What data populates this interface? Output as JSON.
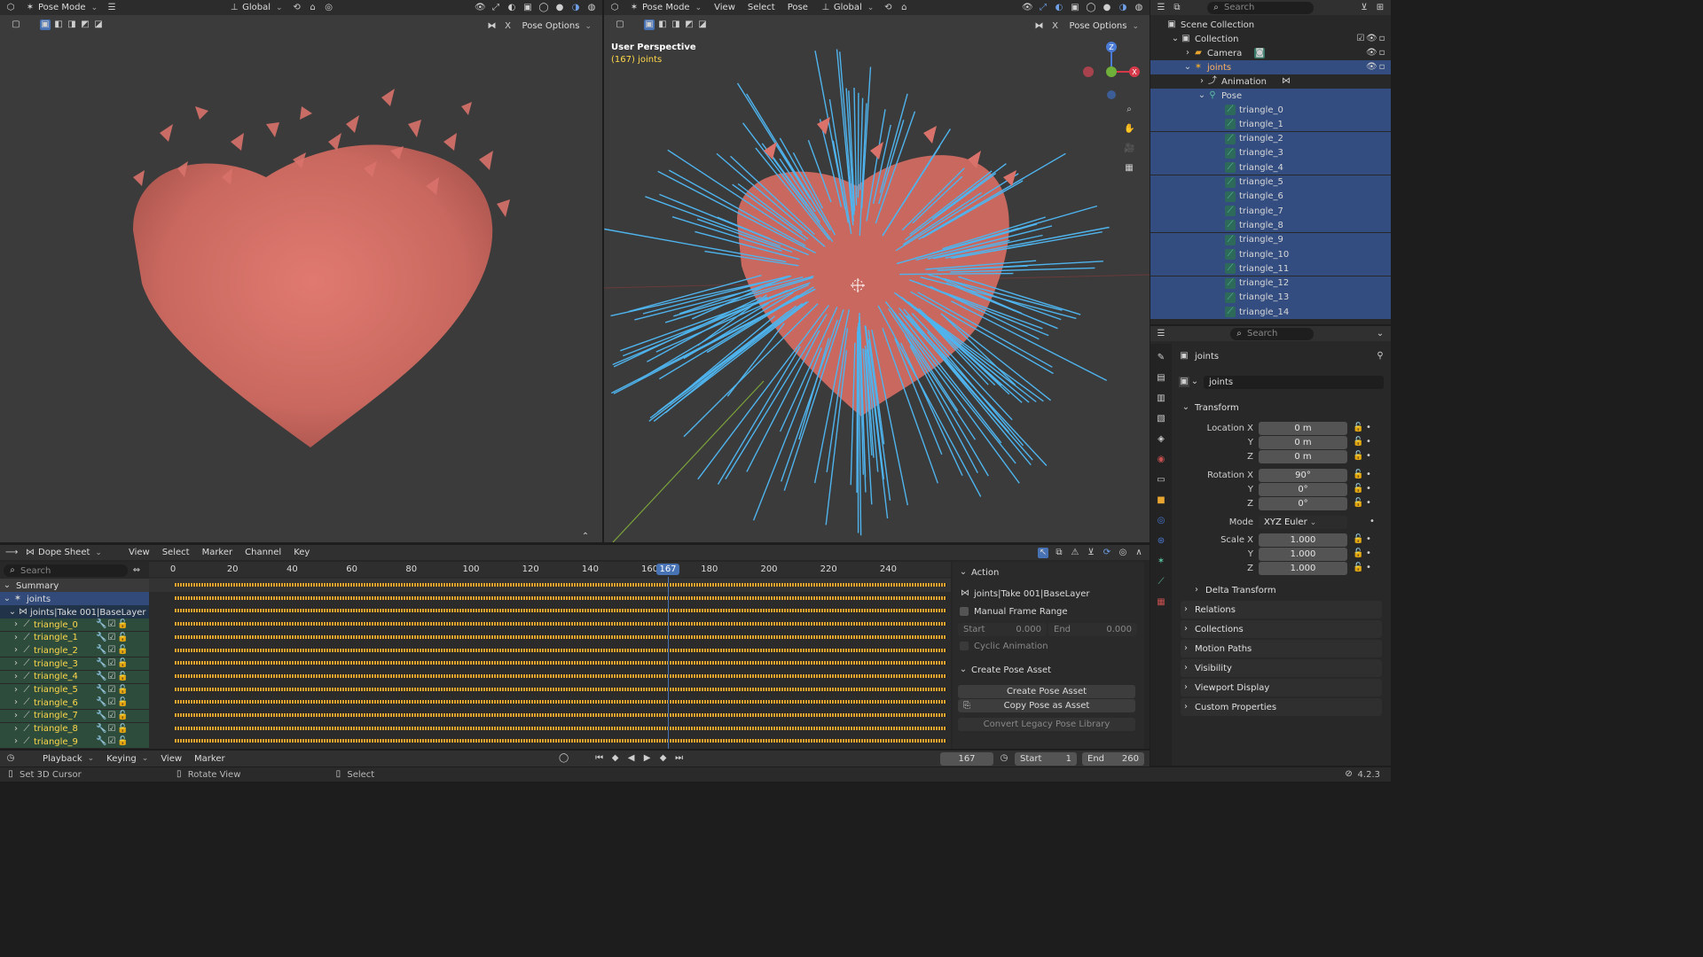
{
  "vp_left_header": {
    "mode": "Pose Mode",
    "transform": "Global",
    "pose_options": "Pose Options"
  },
  "vp_right_header": {
    "mode": "Pose Mode",
    "menus": [
      "View",
      "Select",
      "Pose"
    ],
    "transform": "Global",
    "pose_options": "Pose Options",
    "overlay_title": "User Perspective",
    "overlay_sub": "(167) joints"
  },
  "outliner": {
    "search_placeholder": "Search",
    "scene_collection": "Scene Collection",
    "collection": "Collection",
    "camera": "Camera",
    "joints": "joints",
    "animation": "Animation",
    "pose": "Pose",
    "bones": [
      "triangle_0",
      "triangle_1",
      "triangle_2",
      "triangle_3",
      "triangle_4",
      "triangle_5",
      "triangle_6",
      "triangle_7",
      "triangle_8",
      "triangle_9",
      "triangle_10",
      "triangle_11",
      "triangle_12",
      "triangle_13",
      "triangle_14"
    ]
  },
  "properties": {
    "search_placeholder": "Search",
    "object_name": "joints",
    "datablock": "joints",
    "transform_title": "Transform",
    "location_label": "Location X",
    "location": [
      "0 m",
      "0 m",
      "0 m"
    ],
    "rotation_label": "Rotation X",
    "rotation": [
      "90°",
      "0°",
      "0°"
    ],
    "y_label": "Y",
    "z_label": "Z",
    "mode_label": "Mode",
    "mode_value": "XYZ Euler",
    "scale_label": "Scale X",
    "scale": [
      "1.000",
      "1.000",
      "1.000"
    ],
    "delta_transform": "Delta Transform",
    "sections": [
      "Relations",
      "Collections",
      "Motion Paths",
      "Visibility",
      "Viewport Display",
      "Custom Properties"
    ]
  },
  "dopesheet": {
    "editor": "Dope Sheet",
    "menus": [
      "View",
      "Select",
      "Marker",
      "Channel",
      "Key"
    ],
    "search_placeholder": "Search",
    "ruler": [
      "0",
      "20",
      "40",
      "60",
      "80",
      "100",
      "120",
      "140",
      "160",
      "180",
      "200",
      "220",
      "240"
    ],
    "current_frame": "167",
    "summary": "Summary",
    "joints": "joints",
    "action_row": "joints|Take 001|BaseLayer",
    "channels": [
      "triangle_0",
      "triangle_1",
      "triangle_2",
      "triangle_3",
      "triangle_4",
      "triangle_5",
      "triangle_6",
      "triangle_7",
      "triangle_8",
      "triangle_9"
    ]
  },
  "action_panel": {
    "title": "Action",
    "action_name": "joints|Take 001|BaseLayer",
    "manual_frame_range": "Manual Frame Range",
    "start_label": "Start",
    "start_value": "0.000",
    "end_label": "End",
    "end_value": "0.000",
    "cyclic": "Cyclic Animation",
    "pose_asset_title": "Create Pose Asset",
    "create_pose_asset": "Create Pose Asset",
    "copy_pose_asset": "Copy Pose as Asset",
    "convert_legacy": "Convert Legacy Pose Library"
  },
  "timeline": {
    "menus": [
      "Playback",
      "Keying",
      "View",
      "Marker"
    ],
    "current_frame": "167",
    "start_label": "Start",
    "start_value": "1",
    "end_label": "End",
    "end_value": "260"
  },
  "statusbar": {
    "items": [
      "Set 3D Cursor",
      "Rotate View",
      "Select"
    ],
    "version": "4.2.3"
  },
  "colors": {
    "accent": "#4772b3",
    "bone": "#4fb4ee",
    "heart": "#d9726a",
    "keyframe": "#e8a630",
    "selection": "#334d80"
  }
}
